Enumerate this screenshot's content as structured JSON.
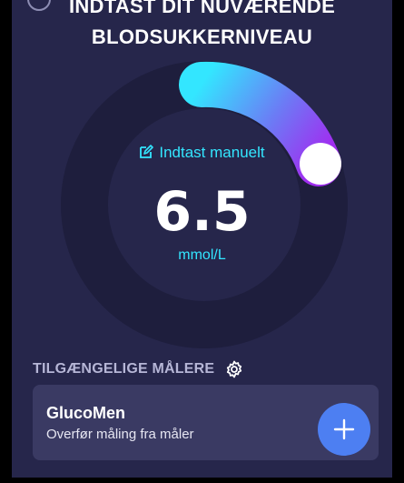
{
  "header": {
    "title_line1": "INDTAST DIT NUVÆRENDE",
    "title_line2": "BLODSUKKERNIVEAU"
  },
  "gauge": {
    "manual_entry_label": "Indtast manuelt",
    "value": "6.5",
    "unit": "mmol/L"
  },
  "meters": {
    "section_title": "TILGÆNGELIGE MÅLERE",
    "items": [
      {
        "name": "GlucoMen",
        "subtitle": "Overfør måling fra måler"
      }
    ]
  },
  "icons": {
    "back": "back-icon",
    "edit": "pencil-edit-icon",
    "settings": "gear-icon",
    "add": "plus-icon"
  },
  "colors": {
    "background": "#26264b",
    "ring": "#1e1e3d",
    "accent_cyan": "#33e6ff",
    "accent_purple": "#a02ef0",
    "card": "#3a3a63",
    "add_button": "#4d7ff2"
  }
}
